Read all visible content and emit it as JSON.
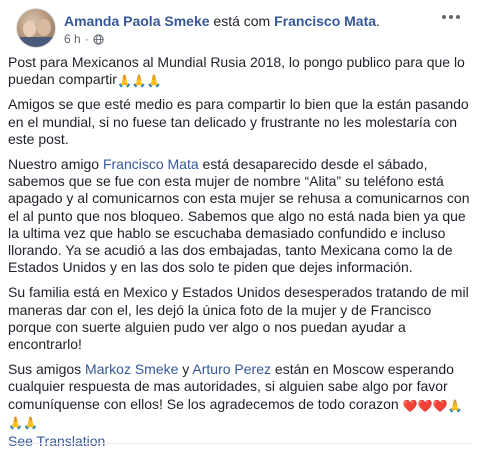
{
  "post": {
    "author": "Amanda Paola Smeke",
    "with_text": "está com",
    "tagged": "Francisco Mata",
    "period": ".",
    "time": "6 h",
    "meta_separator": "·",
    "globe_icon": "globe-icon",
    "more_icon": "more-options-icon",
    "emoji": {
      "hands": "🙏",
      "heart": "❤️"
    },
    "paragraphs": {
      "p1": {
        "text": "Post para Mexicanos al Mundial Rusia 2018, lo pongo publico para que lo puedan compartir"
      },
      "p2": {
        "text": "Amigos se que esté medio es para compartir lo bien que la están pasando en el mundial, si no fuese tan delicado y frustrante no les molestaría con este post."
      },
      "p3": {
        "pre": "Nuestro amigo ",
        "link": "Francisco Mata",
        "post": " está desaparecido desde el sábado, sabemos que se fue con esta mujer de nombre “Alita” su teléfono está apagado y al comunicarnos con esta mujer se rehusa a comunicarnos con el al punto que nos bloqueo. Sabemos que algo no está nada bien ya que la ultima vez que hablo se escuchaba demasiado confundido e incluso llorando. Ya se acudió a las dos embajadas, tanto Mexicana como la de Estados Unidos y en las dos solo te piden que dejes información."
      },
      "p4": {
        "text": "Su familia está en Mexico y Estados Unidos desesperados tratando de mil maneras dar con el, les dejó la única foto de la mujer y de Francisco porque con suerte alguien pudo ver algo o nos puedan ayudar a encontrarlo!"
      },
      "p5": {
        "pre": "Sus amigos ",
        "link1": "Markoz Smeke",
        "mid": " y ",
        "link2": "Arturo Perez",
        "post": " están en Moscow esperando cualquier respuesta de mas autoridades, si alguien sabe algo por favor comuníquense con ellos! Se los agradecemos de todo corazon "
      }
    },
    "see_translation": "See Translation"
  }
}
